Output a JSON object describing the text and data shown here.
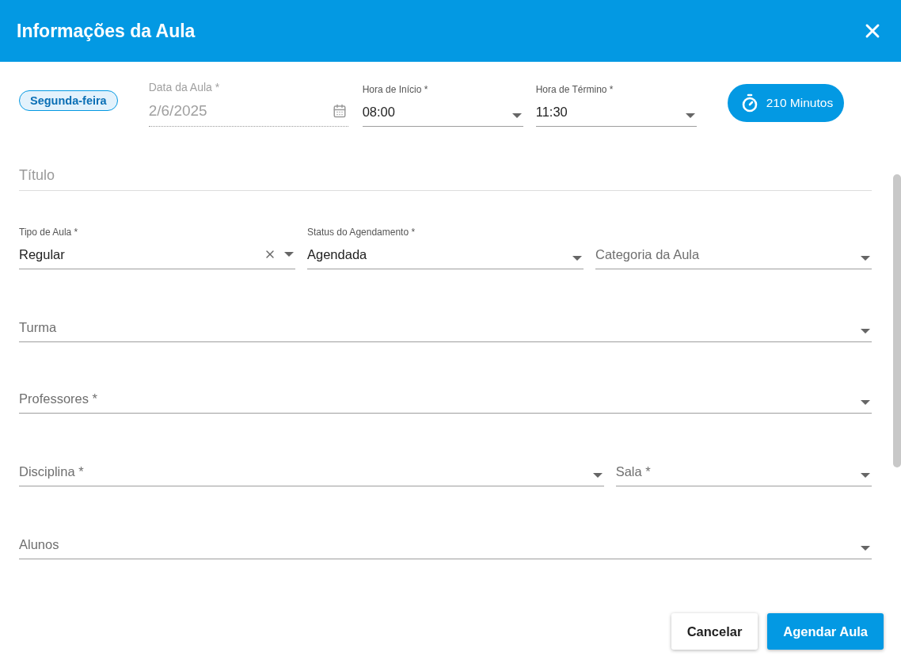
{
  "dialog": {
    "title": "Informações da Aula"
  },
  "weekday_chip": "Segunda-feira",
  "date_field": {
    "label": "Data da Aula *",
    "value": "2/6/2025",
    "disabled": true
  },
  "time_fields": [
    {
      "label": "Hora de Início *",
      "value": "08:00"
    },
    {
      "label": "Hora de Término *",
      "value": "11:30"
    }
  ],
  "duration_button": "210 Minutos",
  "title_field": {
    "placeholder": "Título"
  },
  "rows": [
    [
      {
        "label": "Tipo de Aula *",
        "value": "Regular",
        "clearable": true
      },
      {
        "label": "Status do Agendamento *",
        "value": "Agendada"
      },
      {
        "label": "Categoria da Aula"
      }
    ],
    [
      {
        "label": "Turma"
      }
    ],
    [
      {
        "label": "Professores *"
      }
    ],
    [
      {
        "label": "Disciplina *"
      },
      {
        "label": "Sala *"
      }
    ],
    [
      {
        "label": "Alunos"
      }
    ]
  ],
  "buttons": [
    {
      "label": "Cancelar",
      "kind": "secondary"
    },
    {
      "label": "Agendar Aula",
      "kind": "primary"
    }
  ]
}
